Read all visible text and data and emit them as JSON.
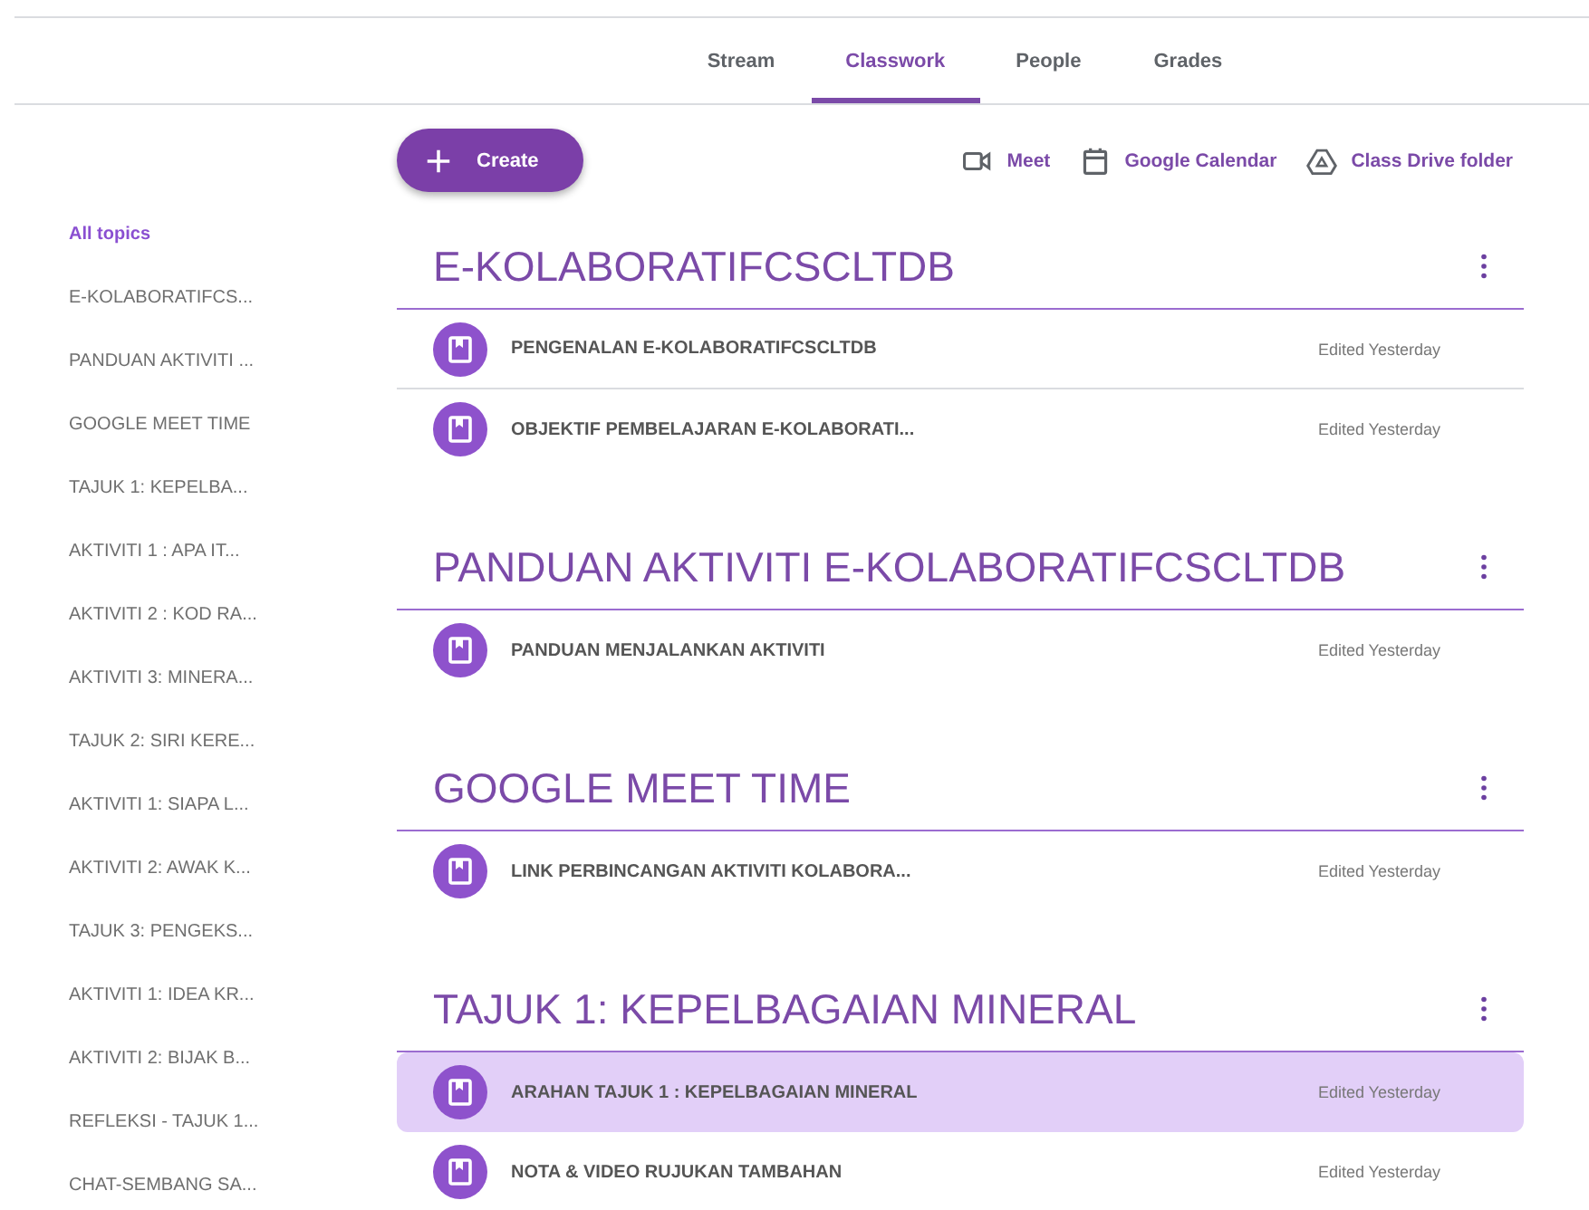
{
  "tabs": [
    {
      "label": "Stream",
      "selected": false
    },
    {
      "label": "Classwork",
      "selected": true
    },
    {
      "label": "People",
      "selected": false
    },
    {
      "label": "Grades",
      "selected": false
    }
  ],
  "create_button": {
    "label": "Create"
  },
  "toolbar_links": [
    {
      "kind": "meet",
      "label": "Meet"
    },
    {
      "kind": "calendar",
      "label": "Google Calendar"
    },
    {
      "kind": "drive",
      "label": "Class Drive folder"
    }
  ],
  "sidebar": {
    "items": [
      {
        "label": "All topics",
        "selected": true
      },
      {
        "label": "E-KOLABORATIFCS...",
        "selected": false
      },
      {
        "label": "PANDUAN AKTIVITI ...",
        "selected": false
      },
      {
        "label": "GOOGLE MEET TIME",
        "selected": false
      },
      {
        "label": "TAJUK 1: KEPELBA...",
        "selected": false
      },
      {
        "label": "AKTIVITI 1 : APA IT...",
        "selected": false
      },
      {
        "label": "AKTIVITI 2 : KOD RA...",
        "selected": false
      },
      {
        "label": "AKTIVITI 3: MINERA...",
        "selected": false
      },
      {
        "label": "TAJUK 2: SIRI KERE...",
        "selected": false
      },
      {
        "label": "AKTIVITI 1: SIAPA L...",
        "selected": false
      },
      {
        "label": "AKTIVITI 2: AWAK K...",
        "selected": false
      },
      {
        "label": "TAJUK 3: PENGEKS...",
        "selected": false
      },
      {
        "label": "AKTIVITI 1: IDEA KR...",
        "selected": false
      },
      {
        "label": "AKTIVITI 2: BIJAK B...",
        "selected": false
      },
      {
        "label": "REFLEKSI - TAJUK 1...",
        "selected": false
      },
      {
        "label": "CHAT-SEMBANG SA...",
        "selected": false
      }
    ]
  },
  "topics": [
    {
      "title": "E-KOLABORATIFCSCLTDB",
      "items": [
        {
          "title": "PENGENALAN E-KOLABORATIFCSCLTDB",
          "edited": "Edited Yesterday",
          "selected": false
        },
        {
          "title": "OBJEKTIF PEMBELAJARAN E-KOLABORATI...",
          "edited": "Edited Yesterday",
          "selected": false
        }
      ]
    },
    {
      "title": "PANDUAN AKTIVITI E-KOLABORATIFCSCLTDB",
      "items": [
        {
          "title": "PANDUAN MENJALANKAN AKTIVITI",
          "edited": "Edited Yesterday",
          "selected": false
        }
      ]
    },
    {
      "title": "GOOGLE MEET TIME",
      "items": [
        {
          "title": "LINK PERBINCANGAN AKTIVITI KOLABORA...",
          "edited": "Edited Yesterday",
          "selected": false
        }
      ]
    },
    {
      "title": "TAJUK 1: KEPELBAGAIAN MINERAL",
      "items": [
        {
          "title": "ARAHAN TAJUK 1 : KEPELBAGAIAN MINERAL",
          "edited": "Edited Yesterday",
          "selected": true
        },
        {
          "title": "NOTA & VIDEO RUJUKAN TAMBAHAN",
          "edited": "Edited Yesterday",
          "selected": false
        }
      ]
    }
  ]
}
